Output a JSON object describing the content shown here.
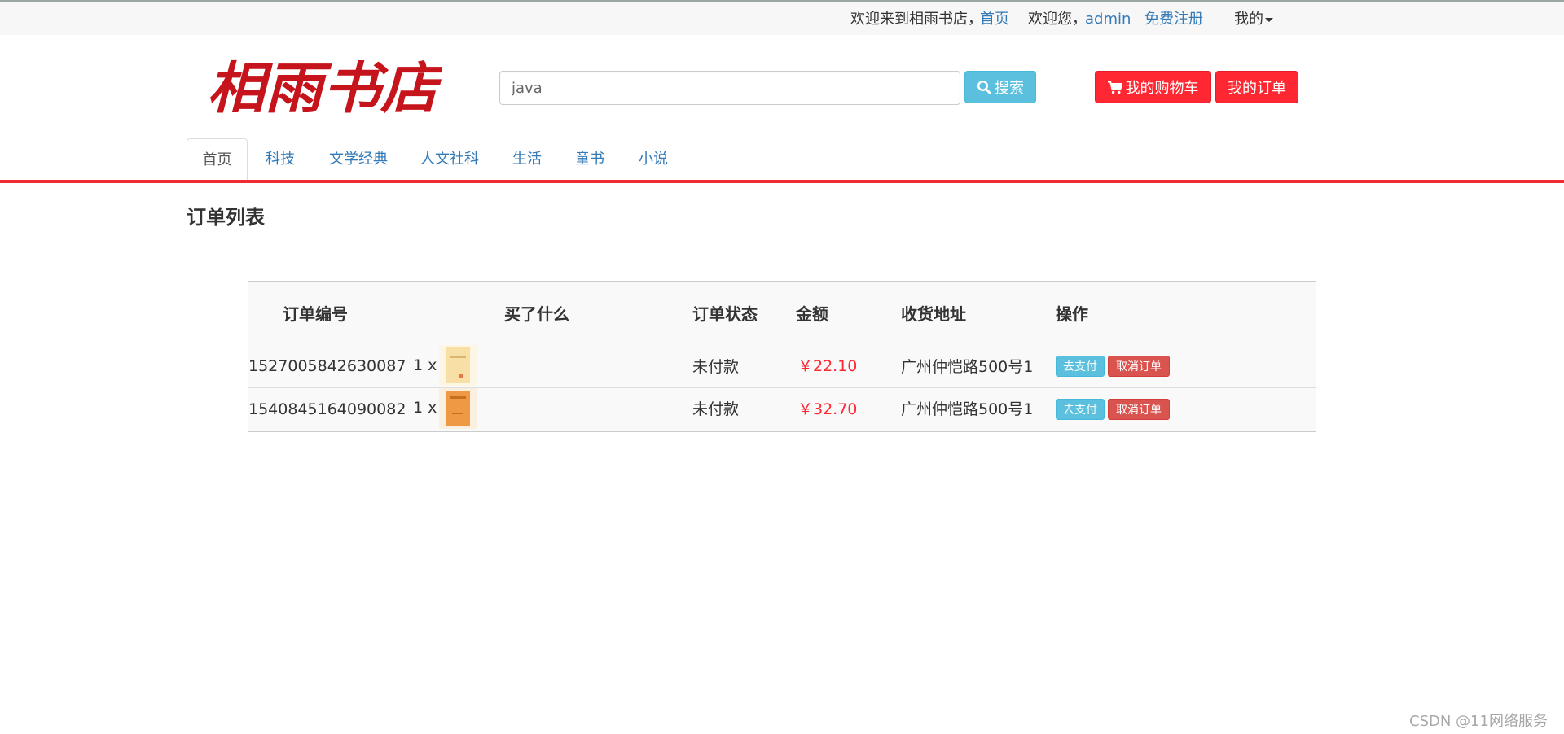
{
  "topbar": {
    "welcome_text": "欢迎来到相雨书店，",
    "home_link": "首页",
    "greeting": "欢迎您，",
    "username": "admin",
    "register_link": "免费注册",
    "my_menu": "我的"
  },
  "header": {
    "logo_text": "相雨书店",
    "search_value": "java",
    "search_button": "搜索",
    "cart_button": "我的购物车",
    "orders_button": "我的订单",
    "search_icon": "search-icon",
    "cart_icon": "shopping-cart-icon"
  },
  "nav": {
    "items": [
      "首页",
      "科技",
      "文学经典",
      "人文社科",
      "生活",
      "童书",
      "小说"
    ],
    "active": "首页"
  },
  "page": {
    "title": "订单列表"
  },
  "table": {
    "headers": [
      "订单编号",
      "买了什么",
      "订单状态",
      "金额",
      "收货地址",
      "操作"
    ],
    "rows": [
      {
        "order_no": "1527005842630087",
        "quantity": "1 x",
        "status": "未付款",
        "amount": "￥22.10",
        "address": "广州仲恺路500号1",
        "pay_label": "去支付",
        "cancel_label": "取消订单",
        "cover_color": "#f7dfa6"
      },
      {
        "order_no": "1540845164090082",
        "quantity": "1 x",
        "status": "未付款",
        "amount": "￥32.70",
        "address": "广州仲恺路500号1",
        "pay_label": "去支付",
        "cancel_label": "取消订单",
        "cover_color": "#ee9a45"
      }
    ]
  },
  "footer": {
    "watermark": "CSDN @11网络服务"
  },
  "colors": {
    "brand_red": "#ff2832",
    "info_blue": "#5bc0de",
    "danger": "#d9534f",
    "link": "#337ab7"
  }
}
